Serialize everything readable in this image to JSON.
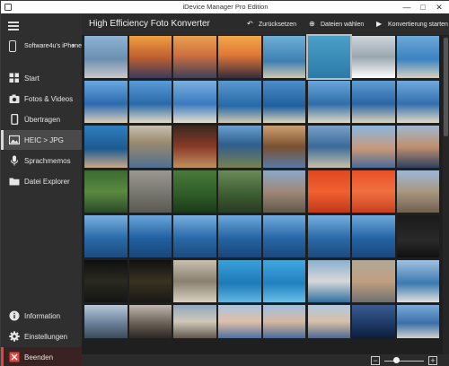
{
  "window": {
    "title": "iDevice Manager Pro Edition",
    "controls": [
      "—",
      "□",
      "✕"
    ]
  },
  "sidebar": {
    "device_label": "Software4u's iPhone",
    "items": [
      {
        "label": "Start",
        "icon": "grid-icon"
      },
      {
        "label": "Fotos & Videos",
        "icon": "camera-icon"
      },
      {
        "label": "Übertragen",
        "icon": "phone-icon"
      },
      {
        "label": "HEIC > JPG",
        "icon": "image-icon",
        "active": true
      },
      {
        "label": "Sprachmemos",
        "icon": "microphone-icon"
      },
      {
        "label": "Datei Explorer",
        "icon": "folder-icon"
      },
      {
        "label": "Information",
        "icon": "info-icon"
      },
      {
        "label": "Einstellungen",
        "icon": "gear-icon"
      },
      {
        "label": "Beenden",
        "icon": "exit-icon",
        "accent": "#e0443a"
      }
    ]
  },
  "header": {
    "title": "High Efficiency Foto Konverter",
    "reset_label": "Zurücksetzen",
    "select_label": "Dateien wählen",
    "convert_label": "Konvertierung starten"
  },
  "colors": {
    "accent_quit": "#e0443a",
    "sidebar_bg": "#2f2f2f",
    "main_bg": "#1f1f1f"
  },
  "zoom": {
    "level": 0.3
  }
}
